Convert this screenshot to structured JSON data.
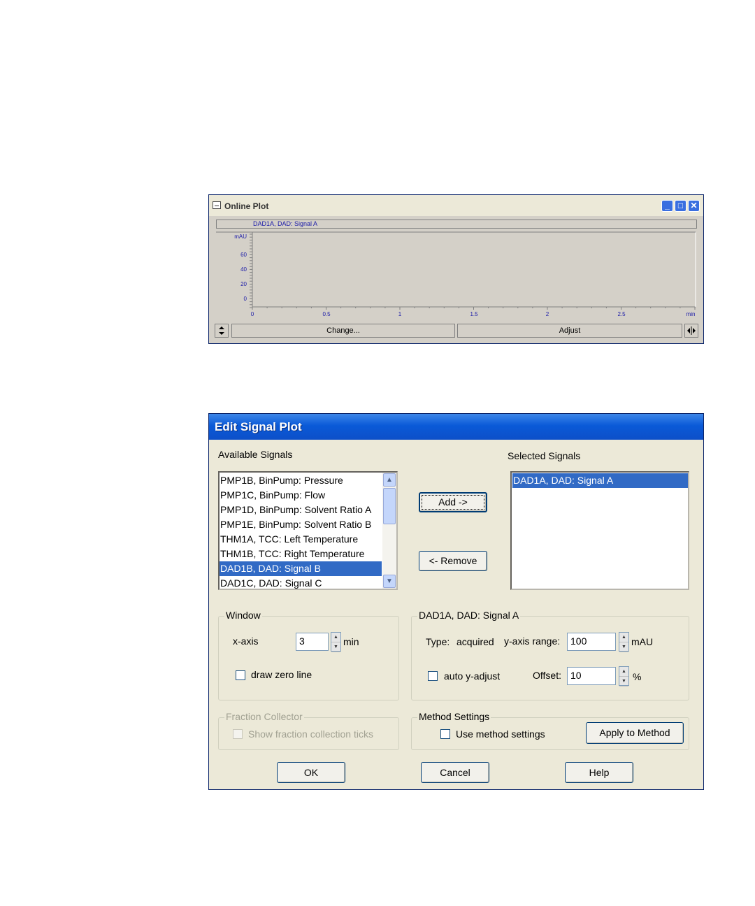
{
  "online_plot": {
    "title": "Online Plot",
    "signal_label": "DAD1A, DAD: Signal A",
    "y_unit": "mAU",
    "y_ticks": [
      "60",
      "40",
      "20",
      "0"
    ],
    "x_ticks": [
      "0",
      "0.5",
      "1",
      "1.5",
      "2",
      "2.5"
    ],
    "x_unit": "min",
    "change_button": "Change...",
    "adjust_button": "Adjust",
    "accent": "#1a1aa8"
  },
  "dialog": {
    "title": "Edit Signal Plot",
    "available_label": "Available Signals",
    "available_signals": [
      "PMP1B, BinPump: Pressure",
      "PMP1C, BinPump: Flow",
      "PMP1D, BinPump: Solvent Ratio A",
      "PMP1E, BinPump: Solvent Ratio B",
      "THM1A, TCC: Left Temperature",
      "THM1B, TCC: Right Temperature",
      "DAD1B, DAD: Signal B",
      "DAD1C, DAD: Signal C"
    ],
    "available_selected": "DAD1B, DAD: Signal B",
    "selected_label": "Selected Signals",
    "selected_signals": [
      "DAD1A, DAD: Signal A"
    ],
    "add_button": "Add ->",
    "remove_button": "<- Remove",
    "window_group": {
      "title": "Window",
      "xaxis_label": "x-axis",
      "xaxis_value": "3",
      "xaxis_unit": "min",
      "draw_zero_label": "draw zero line",
      "draw_zero_checked": false
    },
    "signal_group": {
      "title": "DAD1A, DAD: Signal A",
      "type_label": "Type:",
      "type_value": "acquired",
      "yrange_label": "y-axis range:",
      "yrange_value": "100",
      "yrange_unit": "mAU",
      "auto_adjust_label": "auto y-adjust",
      "auto_adjust_checked": false,
      "offset_label": "Offset:",
      "offset_value": "10",
      "offset_unit": "%"
    },
    "fraction_group": {
      "title": "Fraction Collector",
      "ticks_label": "Show fraction collection ticks",
      "ticks_checked": false
    },
    "method_group": {
      "title": "Method Settings",
      "use_label": "Use method settings",
      "use_checked": false,
      "apply_button": "Apply to Method"
    },
    "ok_button": "OK",
    "cancel_button": "Cancel",
    "help_button": "Help"
  }
}
